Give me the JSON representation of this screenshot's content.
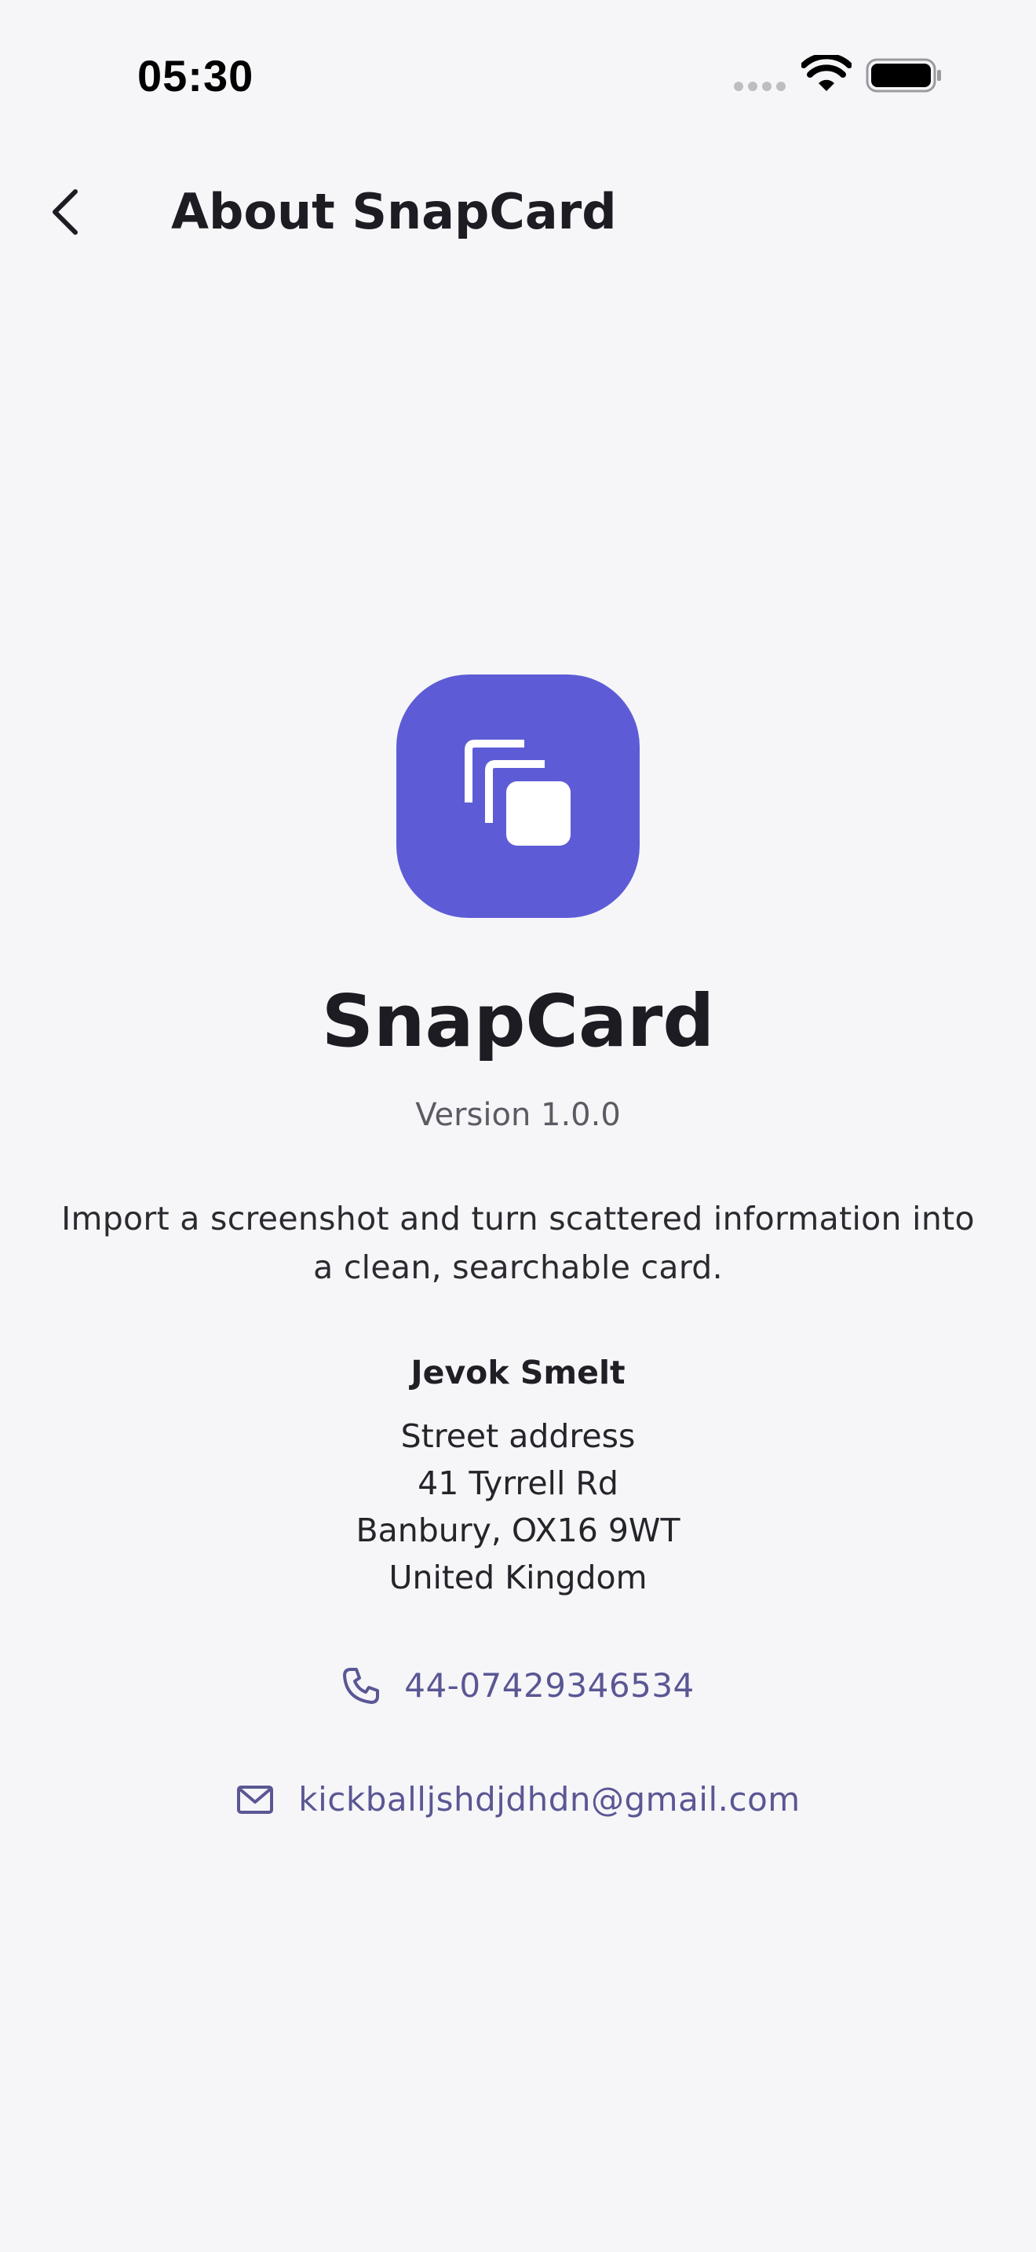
{
  "status_bar": {
    "time": "05:30",
    "icons": [
      "cellular-signal-icon",
      "wifi-icon",
      "battery-icon"
    ]
  },
  "header": {
    "back_icon": "chevron-left-icon",
    "title": "About SnapCard"
  },
  "app": {
    "icon": "stacked-cards-icon",
    "icon_color": "#5D5CD6",
    "name": "SnapCard",
    "version": "Version 1.0.0",
    "description": "Import a screenshot and turn scattered information into a clean, searchable card."
  },
  "developer": {
    "name": "Jevok Smelt",
    "address_lines": [
      "Street address",
      "41 Tyrrell Rd",
      "Banbury, OX16 9WT",
      "United Kingdom"
    ]
  },
  "contact": {
    "phone_icon": "phone-icon",
    "phone": "44-07429346534",
    "email_icon": "mail-icon",
    "email": "kickballjshdjdhdn@gmail.com",
    "link_color": "#5A5794"
  }
}
